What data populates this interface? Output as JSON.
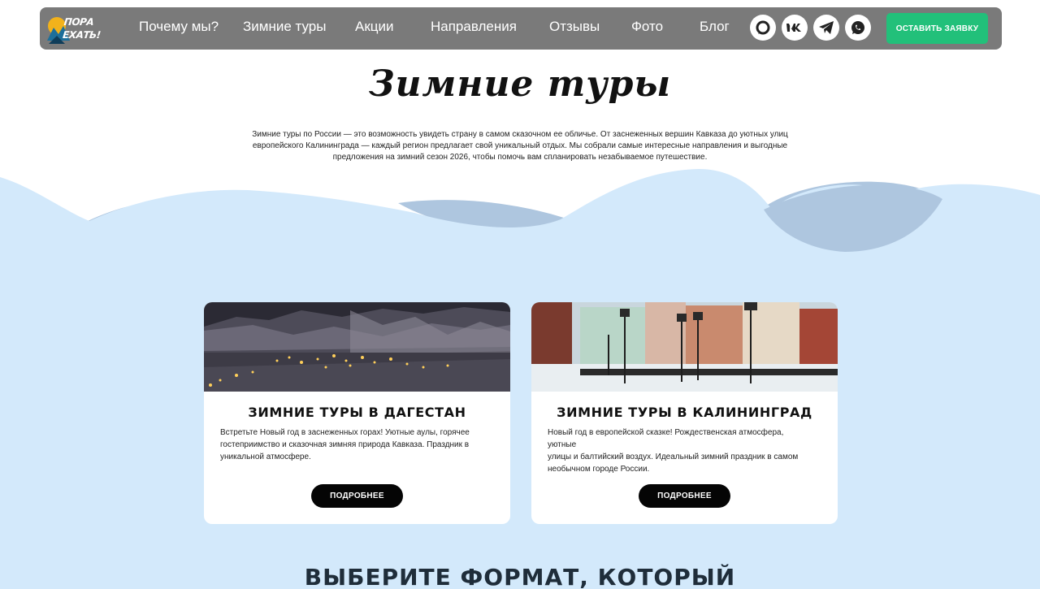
{
  "header": {
    "logo_line1": "ПОРА",
    "logo_line2": "ЕХАТЬ!",
    "nav": [
      "Почему мы?",
      "Зимние туры",
      "Акции",
      "Направления",
      "Отзывы",
      "Фото",
      "Блог"
    ],
    "social_icons": [
      "max-icon",
      "vk-icon",
      "telegram-icon",
      "whatsapp-icon"
    ],
    "cta_label": "ОСТАВИТЬ ЗАЯВКУ"
  },
  "main": {
    "title": "Зимние туры",
    "intro_line1": "Зимние туры по России — это возможность увидеть страну в самом сказочном ее обличье. От заснеженных вершин Кавказа до уютных улиц",
    "intro_line2": "европейского Калининграда — каждый регион предлагает свой уникальный отдых. Мы собрали самые интересные направления и выгодные",
    "intro_line3": "предложения на зимний сезон 2026, чтобы помочь вам спланировать незабываемое путешествие."
  },
  "cards": [
    {
      "title": "ЗИМНИЕ ТУРЫ В ДАГЕСТАН",
      "text_line1": "Встретьте Новый год в заснеженных горах! Уютные аулы, горячее",
      "text_line2": "гостеприимство и сказочная зимняя природа Кавказа. Праздник в",
      "text_line3": "уникальной атмосфере.",
      "button": "ПОДРОБНЕЕ"
    },
    {
      "title": "ЗИМНИЕ ТУРЫ В КАЛИНИНГРАД",
      "text_line1": "Новый год в европейской сказке! Рождественская атмосфера, уютные",
      "text_line2": "улицы и балтийский воздух. Идеальный зимний праздник в самом",
      "text_line3": "необычном городе России.",
      "button": "ПОДРОБНЕЕ"
    }
  ],
  "bottom": {
    "heading": "ВЫБЕРИТЕ ФОРМАТ, КОТОРЫЙ"
  },
  "colors": {
    "header_bg": "#7a7a7a",
    "cta_bg": "#22c07a",
    "section_bg": "#d3e9fb",
    "wave_back": "#a9c4de",
    "button_bg": "#050505"
  }
}
